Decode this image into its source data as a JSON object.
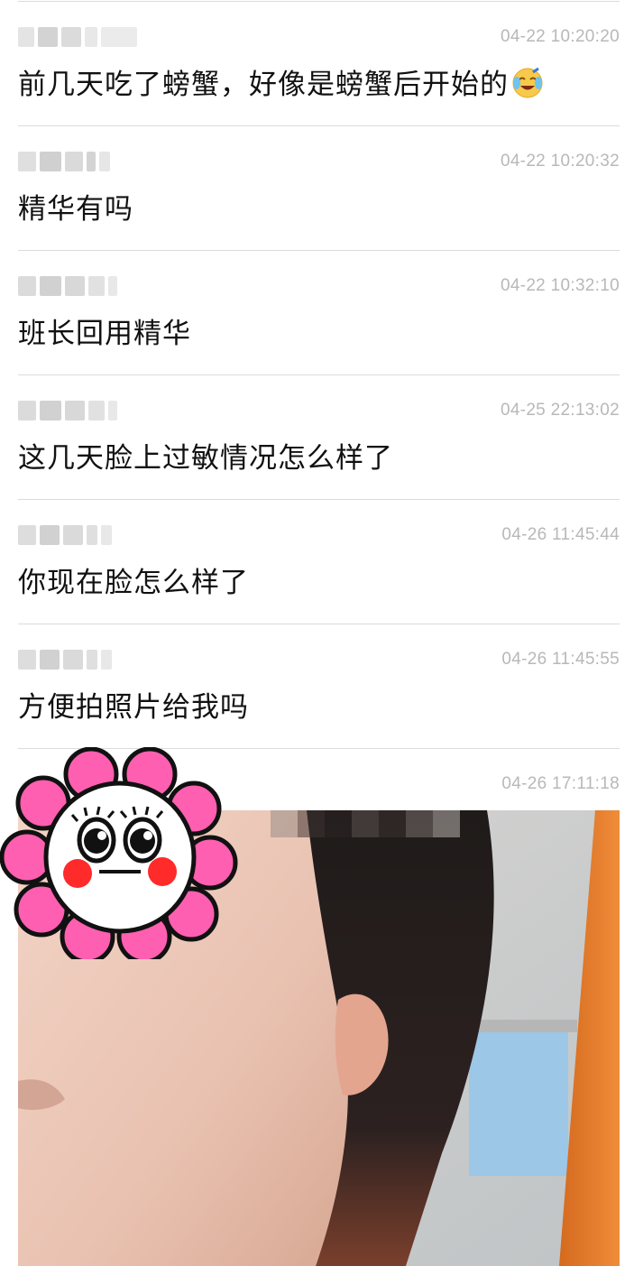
{
  "messages": [
    {
      "time": "04-22 10:20:20",
      "text": "前几天吃了螃蟹，好像是螃蟹后开始的",
      "emoji": "laughing-tears-emoji"
    },
    {
      "time": "04-22 10:20:32",
      "text": "精华有吗"
    },
    {
      "time": "04-22 10:32:10",
      "text": "班长回用精华"
    },
    {
      "time": "04-25 22:13:02",
      "text": "这几天脸上过敏情况怎么样了"
    },
    {
      "time": "04-26 11:45:44",
      "text": "你现在脸怎么样了"
    },
    {
      "time": "04-26 11:45:55",
      "text": "方便拍照片给我吗"
    },
    {
      "time": "04-26 17:11:18",
      "image": "face-photo-with-flower-sticker"
    }
  ],
  "colors": {
    "background": "#ffffff",
    "divider": "#dcdcdc",
    "timestamp": "#b8b8b8",
    "message": "#111111",
    "sticker_petal": "#ff5fb0",
    "sticker_cheek": "#ff2a2a"
  }
}
